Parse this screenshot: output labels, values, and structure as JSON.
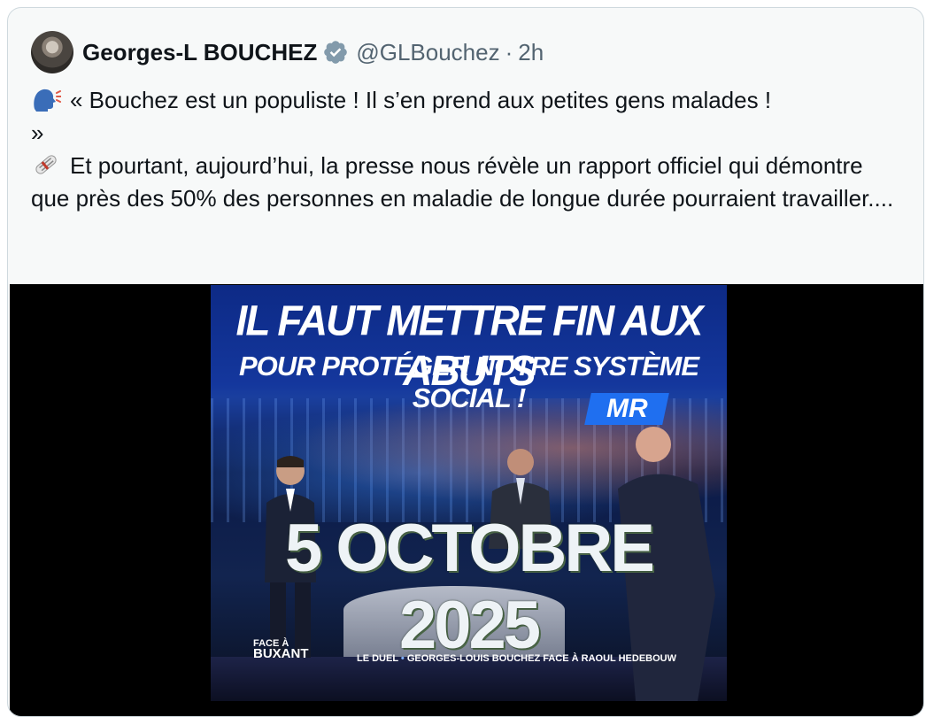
{
  "tweet": {
    "author_name": "Georges-L BOUCHEZ",
    "handle": "@GLBouchez",
    "separator": "·",
    "time": "2h",
    "line1": "« Bouchez est un populiste ! Il s’en prend aux petites gens malades !",
    "line1b": "»",
    "line2": "Et pourtant, aujourd’hui, la presse nous révèle un rapport officiel qui démontre que près des 50% des personnes en maladie de longue durée pourraient travailler....",
    "emoji1": "speaking-head-icon",
    "emoji2": "newspaper-roll-icon"
  },
  "media": {
    "headline1": "IL FAUT METTRE FIN AUX ABUTS",
    "headline2": "POUR PROTÉGER NOTRE SYSTÈME SOCIAL !",
    "badge": "MR",
    "date_overlay": "5 OCTOBRE 2025",
    "show_logo_top": "FACE À",
    "show_logo_bottom": "BUXANT",
    "ticker_label": "LE DUEL",
    "ticker_bullet": "•",
    "ticker_text": "GEORGES-LOUIS BOUCHEZ FACE À RAOUL HEDEBOUW"
  },
  "colors": {
    "verified": "#829aab",
    "handle": "#536471",
    "badge": "#1f6ff0",
    "headline_bg": "#14379d"
  }
}
